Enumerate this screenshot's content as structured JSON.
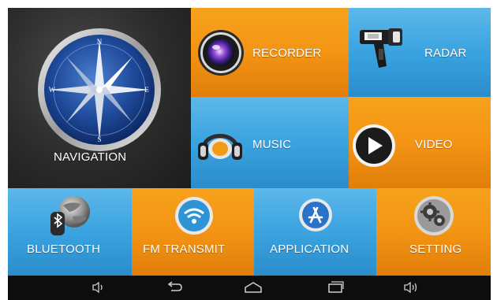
{
  "tiles": {
    "navigation": {
      "label": "NAVIGATION",
      "icon": "compass-icon",
      "color": "#2b2b2b"
    },
    "recorder": {
      "label": "RECORDER",
      "icon": "camera-lens-icon",
      "color": "#f49414"
    },
    "radar": {
      "label": "RADAR",
      "icon": "radar-gun-icon",
      "color": "#3aa3e0"
    },
    "music": {
      "label": "MUSIC",
      "icon": "headphones-icon",
      "color": "#3aa3e0"
    },
    "video": {
      "label": "VIDEO",
      "icon": "play-icon",
      "color": "#f49414"
    },
    "bluetooth": {
      "label": "BLUETOOTH",
      "icon": "bluetooth-globe-icon",
      "color": "#3aa3e0"
    },
    "fm_transmit": {
      "label": "FM TRANSMIT",
      "icon": "wifi-signal-icon",
      "color": "#f49414"
    },
    "application": {
      "label": "APPLICATION",
      "icon": "app-store-icon",
      "color": "#3aa3e0"
    },
    "setting": {
      "label": "SETTING",
      "icon": "gears-icon",
      "color": "#f49414"
    }
  },
  "compass": {
    "north": "N",
    "south": "S",
    "east": "E",
    "west": "W"
  },
  "system_bar": {
    "buttons": [
      "volume-down-icon",
      "back-icon",
      "home-icon",
      "recent-apps-icon",
      "volume-up-icon"
    ]
  }
}
